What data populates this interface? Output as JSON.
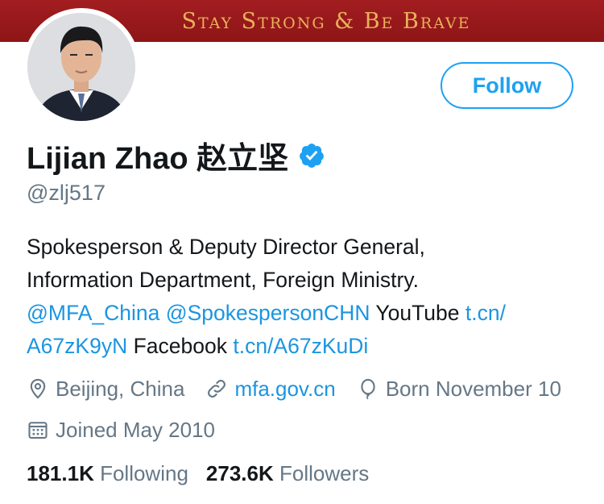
{
  "banner": {
    "text": "Stay Strong & Be Brave"
  },
  "profile": {
    "name": "Lijian Zhao 赵立坚",
    "handle": "@zlj517",
    "verified_icon": "verified-badge-icon",
    "follow_label": "Follow"
  },
  "bio": {
    "line1": "Spokesperson & Deputy Director General,",
    "line2": "Information Department, Foreign Ministry.",
    "mention1": "@MFA_China",
    "mention2": "@SpokespersonCHN",
    "youtube_text": "YouTube",
    "youtube_link_part1": "t.cn/",
    "youtube_link_part2": "A67zK9yN",
    "facebook_text": "Facebook",
    "facebook_link": "t.cn/A67zKuDi"
  },
  "meta": {
    "location": "Beijing, China",
    "website": "mfa.gov.cn",
    "birthday": "Born November 10",
    "joined": "Joined May 2010"
  },
  "stats": {
    "following_count": "181.1K",
    "following_label": "Following",
    "followers_count": "273.6K",
    "followers_label": "Followers"
  },
  "colors": {
    "accent": "#1da1f2",
    "link": "#1b95e0",
    "banner_bg": "#9b1b1e",
    "banner_text": "#e8b25a",
    "muted": "#657786"
  }
}
